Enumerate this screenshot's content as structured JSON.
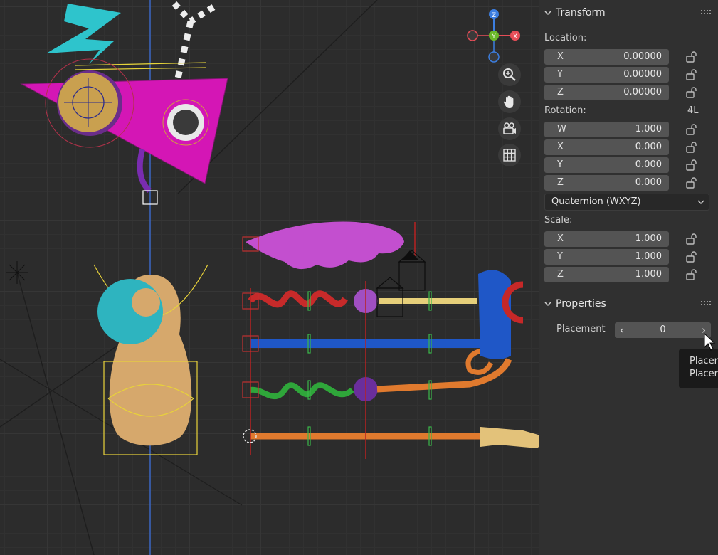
{
  "viewport": {
    "gizmo": {
      "z": "Z",
      "y": "Y",
      "x": "X"
    },
    "tools": [
      "zoom-icon",
      "hand-icon",
      "camera-icon",
      "grid-icon"
    ]
  },
  "panel": {
    "transform": {
      "title": "Transform",
      "location_label": "Location:",
      "location": [
        {
          "axis": "X",
          "value": "0.00000"
        },
        {
          "axis": "Y",
          "value": "0.00000"
        },
        {
          "axis": "Z",
          "value": "0.00000"
        }
      ],
      "rotation_label": "Rotation:",
      "rotation_mode_badge": "4L",
      "rotation": [
        {
          "axis": "W",
          "value": "1.000"
        },
        {
          "axis": "X",
          "value": "0.000"
        },
        {
          "axis": "Y",
          "value": "0.000"
        },
        {
          "axis": "Z",
          "value": "0.000"
        }
      ],
      "rotation_mode": "Quaternion (WXYZ)",
      "scale_label": "Scale:",
      "scale": [
        {
          "axis": "X",
          "value": "1.000"
        },
        {
          "axis": "Y",
          "value": "1.000"
        },
        {
          "axis": "Z",
          "value": "1.000"
        }
      ]
    },
    "properties": {
      "title": "Properties",
      "placement_label": "Placement",
      "placement_value": "0"
    },
    "tooltip": {
      "line1": "Placer",
      "line2": "Placer"
    }
  },
  "colors": {
    "accent_green": "#8bd14b",
    "axis_x": "#e64d57",
    "axis_y": "#6ab82a",
    "axis_z": "#3c7ee0",
    "panel_bg": "#303030",
    "field_bg": "#545454"
  }
}
